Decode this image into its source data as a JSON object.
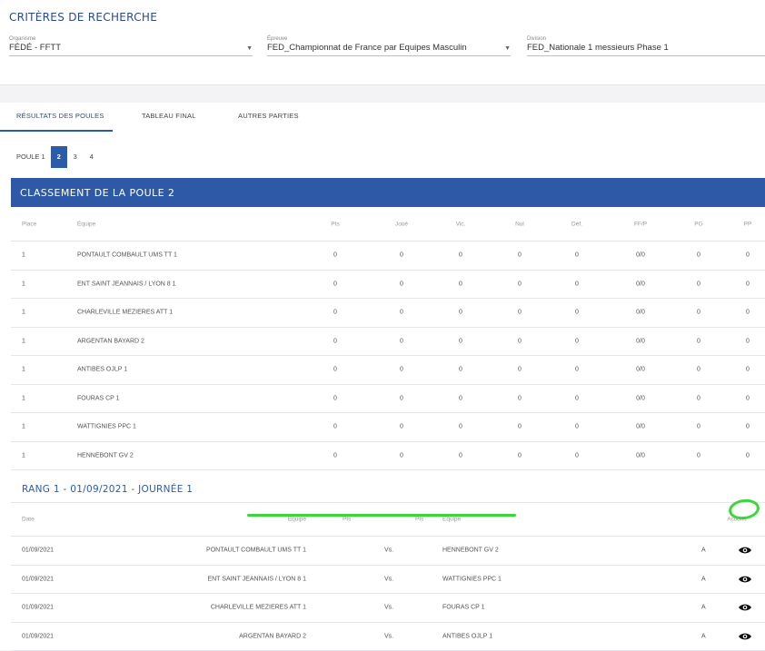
{
  "criteria": {
    "title": "CRITÈRES DE RECHERCHE",
    "organisme": {
      "label": "Organisme",
      "value": "FÉDÉ - FFTT"
    },
    "epreuve": {
      "label": "Épreuve",
      "value": "FED_Championnat de France par Equipes Masculin"
    },
    "division": {
      "label": "Division",
      "value": "FED_Nationale 1 messieurs Phase 1"
    }
  },
  "tabs": [
    "RÉSULTATS DES POULES",
    "TABLEAU FINAL",
    "AUTRES PARTIES"
  ],
  "pager": [
    "POULE 1",
    "2",
    "3",
    "4"
  ],
  "classement": {
    "title": "CLASSEMENT DE LA POULE 2",
    "headers": {
      "place": "Place",
      "team": "Équipe",
      "pts": "Pts",
      "joue": "Joué",
      "vic": "Vic.",
      "nul": "Nul",
      "def": "Déf.",
      "ffp": "FF/P",
      "pg": "PG",
      "pp": "PP"
    },
    "rows": [
      {
        "place": "1",
        "team": "PONTAULT COMBAULT UMS TT 1",
        "pts": "0",
        "joue": "0",
        "vic": "0",
        "nul": "0",
        "def": "0",
        "ffp": "0/0",
        "pg": "0",
        "pp": "0"
      },
      {
        "place": "1",
        "team": "ENT SAINT JEANNAIS / LYON 8 1",
        "pts": "0",
        "joue": "0",
        "vic": "0",
        "nul": "0",
        "def": "0",
        "ffp": "0/0",
        "pg": "0",
        "pp": "0"
      },
      {
        "place": "1",
        "team": "CHARLEVILLE MEZIERES ATT 1",
        "pts": "0",
        "joue": "0",
        "vic": "0",
        "nul": "0",
        "def": "0",
        "ffp": "0/0",
        "pg": "0",
        "pp": "0"
      },
      {
        "place": "1",
        "team": "ARGENTAN BAYARD 2",
        "pts": "0",
        "joue": "0",
        "vic": "0",
        "nul": "0",
        "def": "0",
        "ffp": "0/0",
        "pg": "0",
        "pp": "0"
      },
      {
        "place": "1",
        "team": "ANTIBES OJLP 1",
        "pts": "0",
        "joue": "0",
        "vic": "0",
        "nul": "0",
        "def": "0",
        "ffp": "0/0",
        "pg": "0",
        "pp": "0"
      },
      {
        "place": "1",
        "team": "FOURAS CP 1",
        "pts": "0",
        "joue": "0",
        "vic": "0",
        "nul": "0",
        "def": "0",
        "ffp": "0/0",
        "pg": "0",
        "pp": "0"
      },
      {
        "place": "1",
        "team": "WATTIGNIES PPC 1",
        "pts": "0",
        "joue": "0",
        "vic": "0",
        "nul": "0",
        "def": "0",
        "ffp": "0/0",
        "pg": "0",
        "pp": "0"
      },
      {
        "place": "1",
        "team": "HENNEBONT GV 2",
        "pts": "0",
        "joue": "0",
        "vic": "0",
        "nul": "0",
        "def": "0",
        "ffp": "0/0",
        "pg": "0",
        "pp": "0"
      }
    ]
  },
  "rang": {
    "title": "RANG 1 - 01/09/2021 - JOURNÉE 1",
    "headers": {
      "date": "Date",
      "home": "Équipe",
      "pts1": "Pts",
      "pts2": "Pts",
      "away": "Équipe",
      "actions": "Actions"
    },
    "rows": [
      {
        "date": "01/09/2021",
        "home": "PONTAULT COMBAULT UMS TT 1",
        "vs": "Vs.",
        "away": "HENNEBONT GV 2",
        "flag": "A"
      },
      {
        "date": "01/09/2021",
        "home": "ENT SAINT JEANNAIS / LYON 8 1",
        "vs": "Vs.",
        "away": "WATTIGNIES PPC 1",
        "flag": "A"
      },
      {
        "date": "01/09/2021",
        "home": "CHARLEVILLE MEZIERES ATT 1",
        "vs": "Vs.",
        "away": "FOURAS CP 1",
        "flag": "A"
      },
      {
        "date": "01/09/2021",
        "home": "ARGENTAN BAYARD 2",
        "vs": "Vs.",
        "away": "ANTIBES OJLP 1",
        "flag": "A"
      }
    ]
  },
  "colors": {
    "accent": "#2d59a6",
    "highlight": "#3ad63a"
  }
}
